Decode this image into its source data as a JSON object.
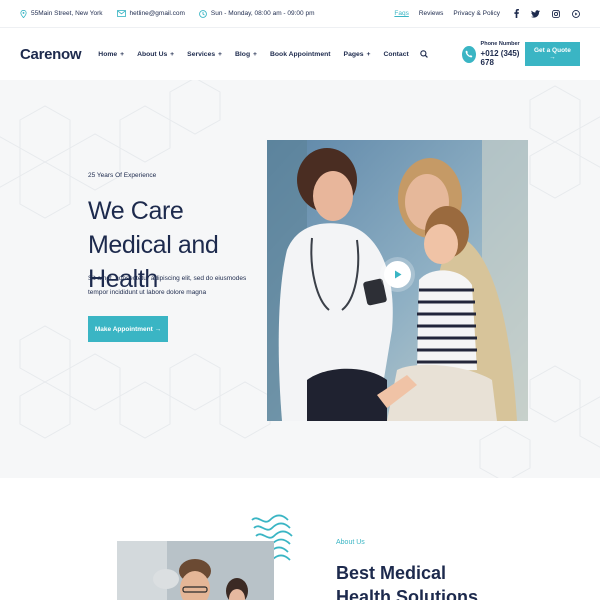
{
  "topbar": {
    "address": "55Main Street, New York",
    "email": "hetline@gmail.com",
    "hours": "Sun - Monday, 08:00 am - 09:00 pm",
    "links": [
      {
        "label": "Faqs"
      },
      {
        "label": "Reviews"
      },
      {
        "label": "Privacy & Policy"
      }
    ],
    "socials": [
      "facebook-icon",
      "twitter-icon",
      "instagram-icon",
      "youtube-icon"
    ]
  },
  "header": {
    "logo": "Carenow",
    "nav": [
      {
        "label": "Home",
        "has_plus": true
      },
      {
        "label": "About Us",
        "has_plus": true
      },
      {
        "label": "Services",
        "has_plus": true
      },
      {
        "label": "Blog",
        "has_plus": true
      },
      {
        "label": "Book Appointment",
        "has_plus": false
      },
      {
        "label": "Pages",
        "has_plus": true
      },
      {
        "label": "Contact",
        "has_plus": false
      }
    ],
    "plus_symbol": "+",
    "phone_label": "Phone Number",
    "phone_number": "+012 (345) 678",
    "quote_button": "Get a Quote →"
  },
  "hero": {
    "kicker": "25 Years Of Experience",
    "title": "We Care Medical and Health",
    "text": "Sit amet, consectetur adipiscing elit, sed do eiusmodes tempor incididunt ut labore dolore magna",
    "button": "Make Appointment →"
  },
  "about": {
    "kicker": "About Us",
    "title": "Best Medical Health Solutions"
  },
  "colors": {
    "accent": "#3ab5c4",
    "navy": "#1d2a4d",
    "hero_bg": "#f6f7f8"
  }
}
